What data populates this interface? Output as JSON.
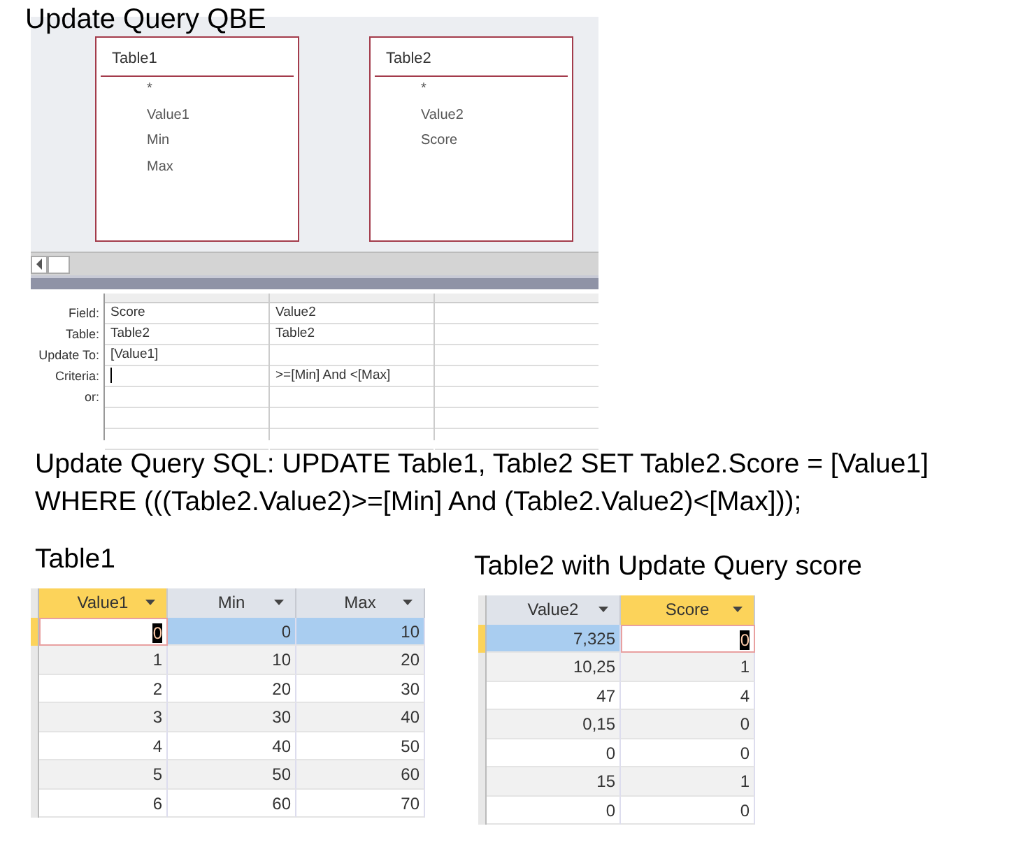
{
  "qbe_title": "Update Query QBE",
  "design_tables": [
    {
      "name": "Table1",
      "fields": [
        "*",
        "Value1",
        "Min",
        "Max"
      ]
    },
    {
      "name": "Table2",
      "fields": [
        "*",
        "Value2",
        "Score"
      ]
    }
  ],
  "qbe_grid": {
    "row_labels": [
      "Field:",
      "Table:",
      "Update To:",
      "Criteria:",
      "or:"
    ],
    "columns": [
      {
        "field": "Score",
        "table": "Table2",
        "update_to": "[Value1]"
      },
      {
        "field": "Value2",
        "table": "Table2",
        "criteria": ">=[Min] And <[Max]"
      }
    ]
  },
  "sql_text": "Update Query SQL: UPDATE Table1, Table2 SET Table2.Score = [Value1] WHERE (((Table2.Value2)>=[Min] And (Table2.Value2)<[Max]));",
  "datasheets": [
    {
      "title": "Table1",
      "columns": [
        {
          "label": "Value1",
          "selected": true
        },
        {
          "label": "Min",
          "selected": false
        },
        {
          "label": "Max",
          "selected": false
        }
      ],
      "rows": [
        {
          "cells": [
            "0",
            "0",
            "10"
          ],
          "selected": true
        },
        {
          "cells": [
            "1",
            "10",
            "20"
          ],
          "selected": false
        },
        {
          "cells": [
            "2",
            "20",
            "30"
          ],
          "selected": false
        },
        {
          "cells": [
            "3",
            "30",
            "40"
          ],
          "selected": false
        },
        {
          "cells": [
            "4",
            "40",
            "50"
          ],
          "selected": false
        },
        {
          "cells": [
            "5",
            "50",
            "60"
          ],
          "selected": false
        },
        {
          "cells": [
            "6",
            "60",
            "70"
          ],
          "selected": false
        }
      ]
    },
    {
      "title": "Table2 with Update Query score",
      "columns": [
        {
          "label": "Value2",
          "selected": false
        },
        {
          "label": "Score",
          "selected": true
        }
      ],
      "rows": [
        {
          "cells": [
            "7,325",
            "0"
          ],
          "selected": true
        },
        {
          "cells": [
            "10,25",
            "1"
          ],
          "selected": false
        },
        {
          "cells": [
            "47",
            "4"
          ],
          "selected": false
        },
        {
          "cells": [
            "0,15",
            "0"
          ],
          "selected": false
        },
        {
          "cells": [
            "0",
            "0"
          ],
          "selected": false
        },
        {
          "cells": [
            "15",
            "1"
          ],
          "selected": false
        },
        {
          "cells": [
            "0",
            "0"
          ],
          "selected": false
        }
      ]
    }
  ]
}
